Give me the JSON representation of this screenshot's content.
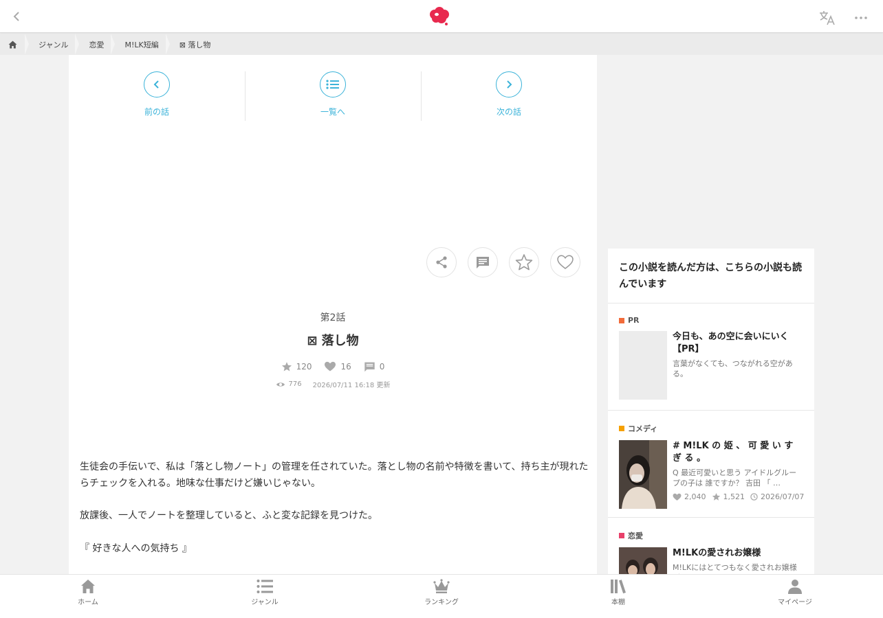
{
  "breadcrumb": [
    "ジャンル",
    "恋愛",
    "M!LK短編",
    "⊠ 落し物"
  ],
  "episode_nav": {
    "prev": "前の話",
    "list": "一覧へ",
    "next": "次の話"
  },
  "chapter": {
    "number": "第2話",
    "title": "⊠ 落し物",
    "stars": "120",
    "likes": "16",
    "comments": "0",
    "views": "776",
    "updated": "2026/07/11 16:18 更新"
  },
  "body": [
    "生徒会の手伝いで、私は「落とし物ノート」の管理を任されていた。落とし物の名前や特徴を書いて、持ち主が現れたらチェックを入れる。地味な仕事だけど嫌いじゃない。",
    "放課後、一人でノートを整理していると、ふと変な記録を見つけた。",
    "『 好きな人への気持ち 』"
  ],
  "sidebar": {
    "heading": "この小説を読んだ方は、こちらの小説も読んでいます",
    "cards": [
      {
        "tag": "PR",
        "tag_color": "#f26b3a",
        "title": "今日も、あの空に会いにいく【PR】",
        "desc": "言葉がなくても、つながれる空がある。"
      },
      {
        "tag": "コメディ",
        "tag_color": "#f5a000",
        "title": "# M!LK の 姫 、 可 愛 い す ぎ る 。",
        "desc": "Q 最近可愛いと思う アイドルグループの子は 誰ですか？ 吉田 「 …",
        "likes": "2,040",
        "stars": "1,521",
        "date": "2026/07/07"
      },
      {
        "tag": "恋愛",
        "tag_color": "#e8406a",
        "title": "M!LKの愛されお嬢様",
        "desc": "M!LKにはとてつもなく愛されお嬢様がいるらしい…"
      }
    ]
  },
  "bottom_tabs": [
    "ホーム",
    "ジャンル",
    "ランキング",
    "本棚",
    "マイページ"
  ],
  "colors": {
    "accent": "#3bb3d9",
    "logo": "#e8294e"
  }
}
